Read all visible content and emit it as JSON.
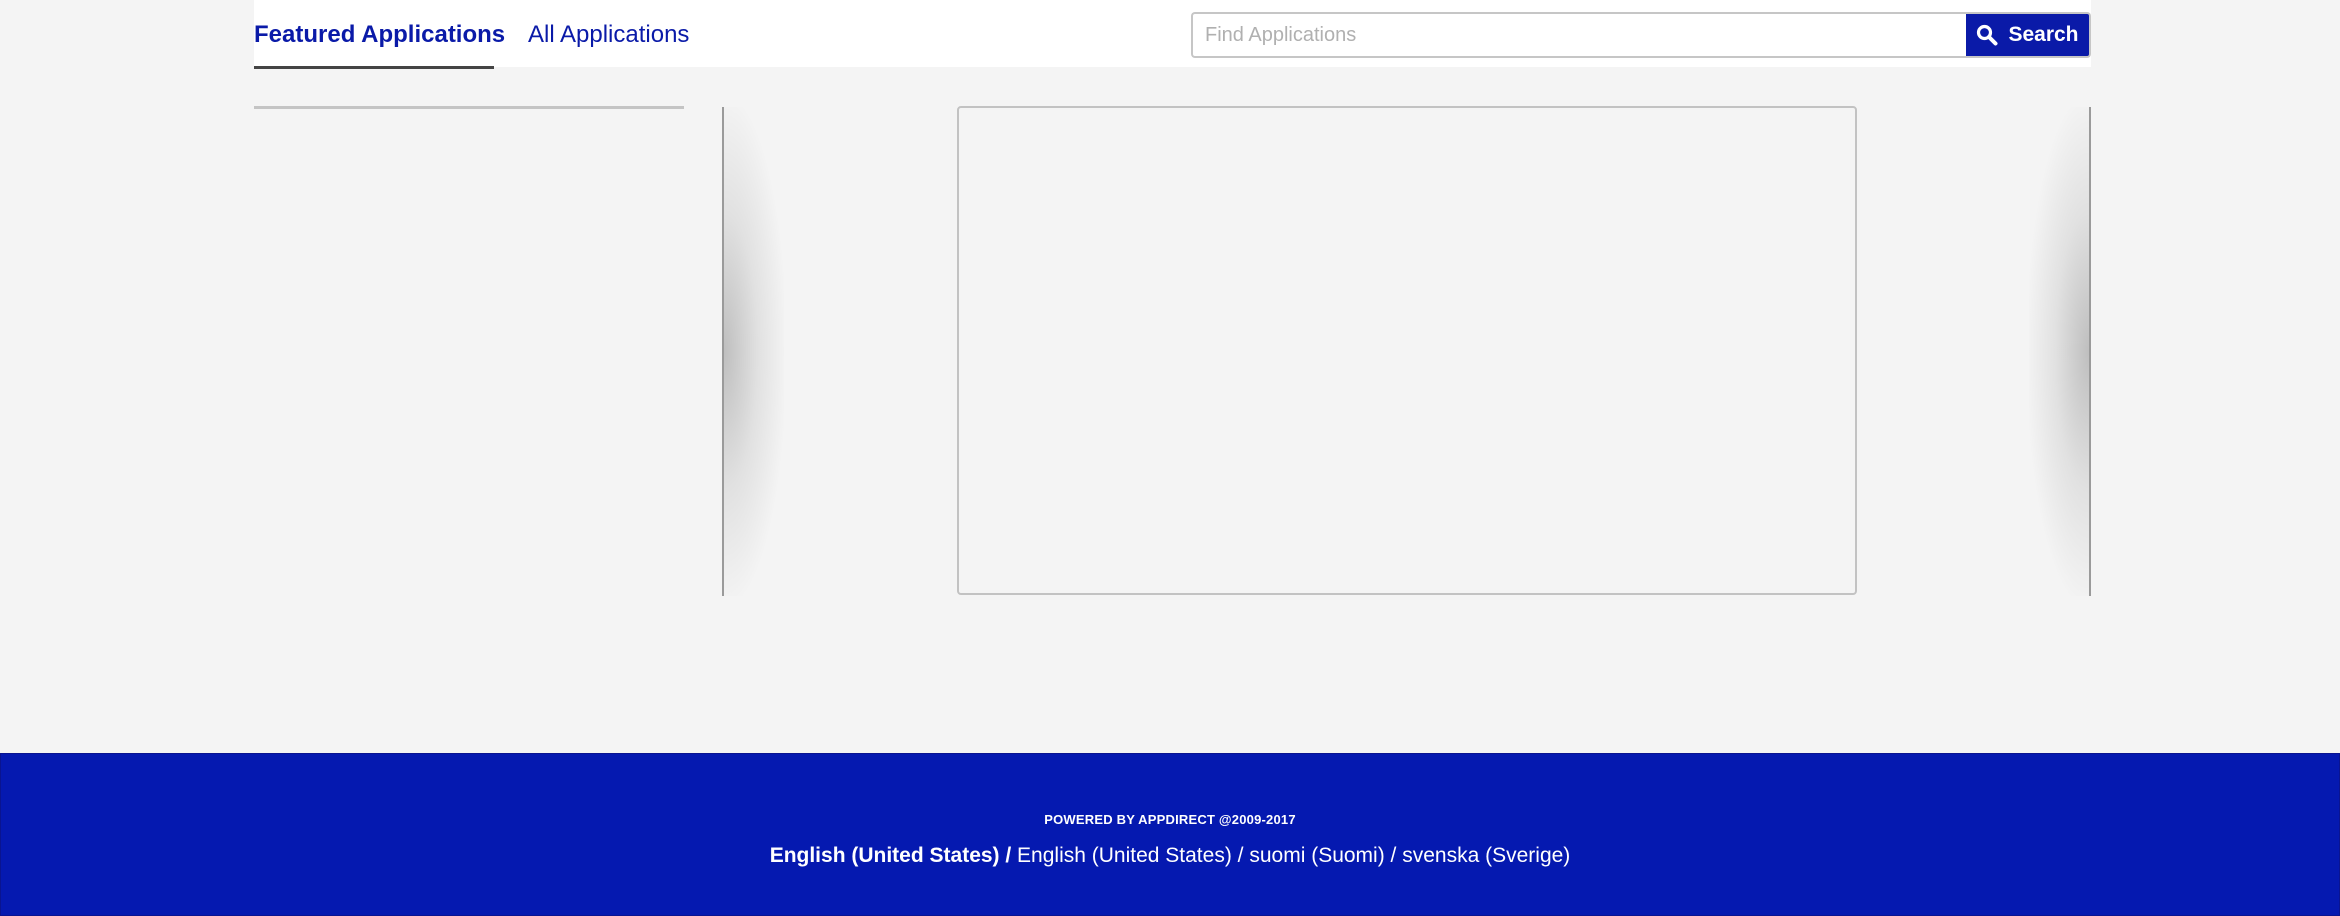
{
  "header": {
    "tabs": [
      {
        "label": "Featured Applications",
        "active": true
      },
      {
        "label": "All Applications",
        "active": false
      }
    ],
    "search": {
      "placeholder": "Find Applications",
      "value": "",
      "button_label": "Search",
      "button_icon": "search-icon"
    }
  },
  "footer": {
    "powered_by": "POWERED BY APPDIRECT @2009-2017",
    "current_language": "English (United States) /",
    "languages": [
      "English (United States)",
      "suomi (Suomi)",
      "svenska (Sverige)"
    ],
    "separator": " / "
  },
  "colors": {
    "brand": "#0a1aa8",
    "footer_bg": "#0519b0",
    "page_bg": "#f4f4f4"
  }
}
